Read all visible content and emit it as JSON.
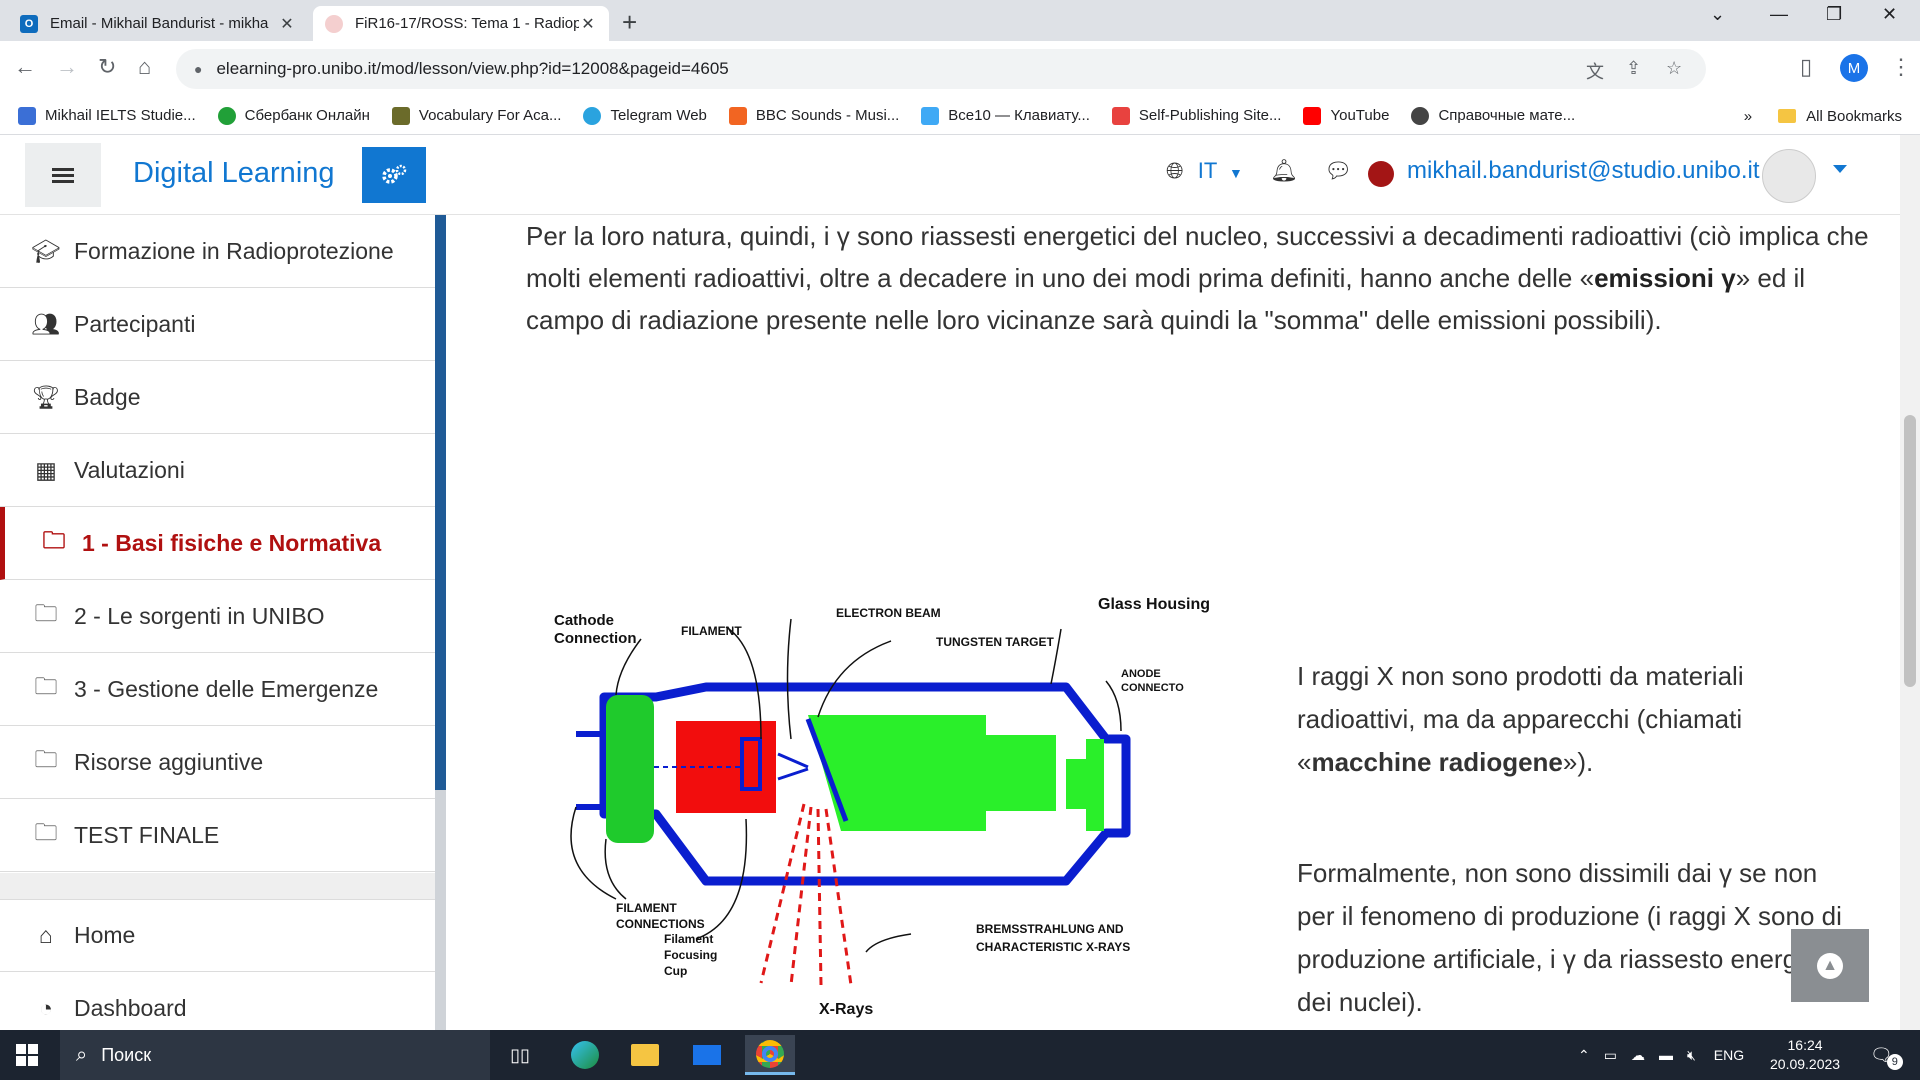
{
  "browser": {
    "tabs": [
      {
        "title": "Email - Mikhail Bandurist - mikha",
        "icon": "outlook-icon",
        "color": "#0f6cbd"
      },
      {
        "title": "FiR16-17/ROSS: Tema 1 - Radiop",
        "icon": "moodle-icon",
        "color": "#f4a6a6"
      }
    ],
    "url": "elearning-pro.unibo.it/mod/lesson/view.php?id=12008&pageid=4605",
    "profile_initial": "M",
    "bookmarks": [
      {
        "label": "Mikhail IELTS Studie...",
        "color": "#3b6fd6"
      },
      {
        "label": "Сбербанк Онлайн",
        "color": "#21a038"
      },
      {
        "label": "Vocabulary For Aca...",
        "color": "#6b6b2a"
      },
      {
        "label": "Telegram Web",
        "color": "#2aa3df"
      },
      {
        "label": "BBC Sounds - Musi...",
        "color": "#f26522"
      },
      {
        "label": "Все10 — Клавиату...",
        "color": "#3fa9f5"
      },
      {
        "label": "Self-Publishing Site...",
        "color": "#e8423f"
      },
      {
        "label": "YouTube",
        "color": "#ff0000"
      },
      {
        "label": "Справочные мате...",
        "color": "#444444"
      }
    ],
    "bookmarks_more": "»",
    "all_bookmarks": "All Bookmarks"
  },
  "header": {
    "brand": "Digital Learning",
    "language": "IT",
    "user_email": "mikhail.bandurist@studio.unibo.it"
  },
  "sidebar": {
    "items": [
      {
        "label": "Formazione in Radioprotezione",
        "icon": "graduation-cap-icon"
      },
      {
        "label": "Partecipanti",
        "icon": "users-icon"
      },
      {
        "label": "Badge",
        "icon": "trophy-icon"
      },
      {
        "label": "Valutazioni",
        "icon": "table-icon"
      },
      {
        "label": "1 - Basi fisiche e Normativa",
        "icon": "folder-icon",
        "active": true
      },
      {
        "label": "2 - Le sorgenti in UNIBO",
        "icon": "folder-icon"
      },
      {
        "label": "3 - Gestione delle Emergenze",
        "icon": "folder-icon"
      },
      {
        "label": "Risorse aggiuntive",
        "icon": "folder-icon"
      },
      {
        "label": "TEST FINALE",
        "icon": "folder-icon"
      }
    ],
    "bottom_items": [
      {
        "label": "Home",
        "icon": "home-icon"
      },
      {
        "label": "Dashboard",
        "icon": "dashboard-icon"
      }
    ]
  },
  "content": {
    "para1_a": "Per la loro natura, quindi, i γ sono riassesti energetici del nucleo, successivi a decadimenti radioattivi (ciò implica che molti elementi radioattivi, oltre a decadere in uno dei modi prima definiti, hanno anche delle «",
    "para1_bold": "emissioni γ",
    "para1_b": "» ed il campo di radiazione presente nelle loro vicinanze sarà quindi la \"somma\" delle emissioni possibili).",
    "para2_a": "I raggi X non sono prodotti da materiali radioattivi, ma da apparecchi (chiamati «",
    "para2_bold": "macchine radiogene",
    "para2_b": "»).",
    "para3": "Formalmente, non sono dissimili dai γ se non per il fenomeno di produzione (i raggi X sono di produzione artificiale, i γ da riassesto energetico dei nuclei).",
    "diagram_labels": {
      "cathode": "Cathode Connection",
      "filament": "FILAMENT",
      "electron_beam": "ELECTRON BEAM",
      "glass_housing": "Glass Housing",
      "tungsten_target": "TUNGSTEN TARGET",
      "anode": "ANODE CONNECTO",
      "filament_connections": "FILAMENT CONNECTIONS",
      "filament_cup": "Filament Focusing Cup",
      "xrays": "X-Rays",
      "brems": "BREMSSTRAHLUNG AND CHARACTERISTIC X-RAYS"
    }
  },
  "taskbar": {
    "search_placeholder": "Поиск",
    "lang": "ENG",
    "time": "16:24",
    "date": "20.09.2023",
    "notifications": "9"
  }
}
